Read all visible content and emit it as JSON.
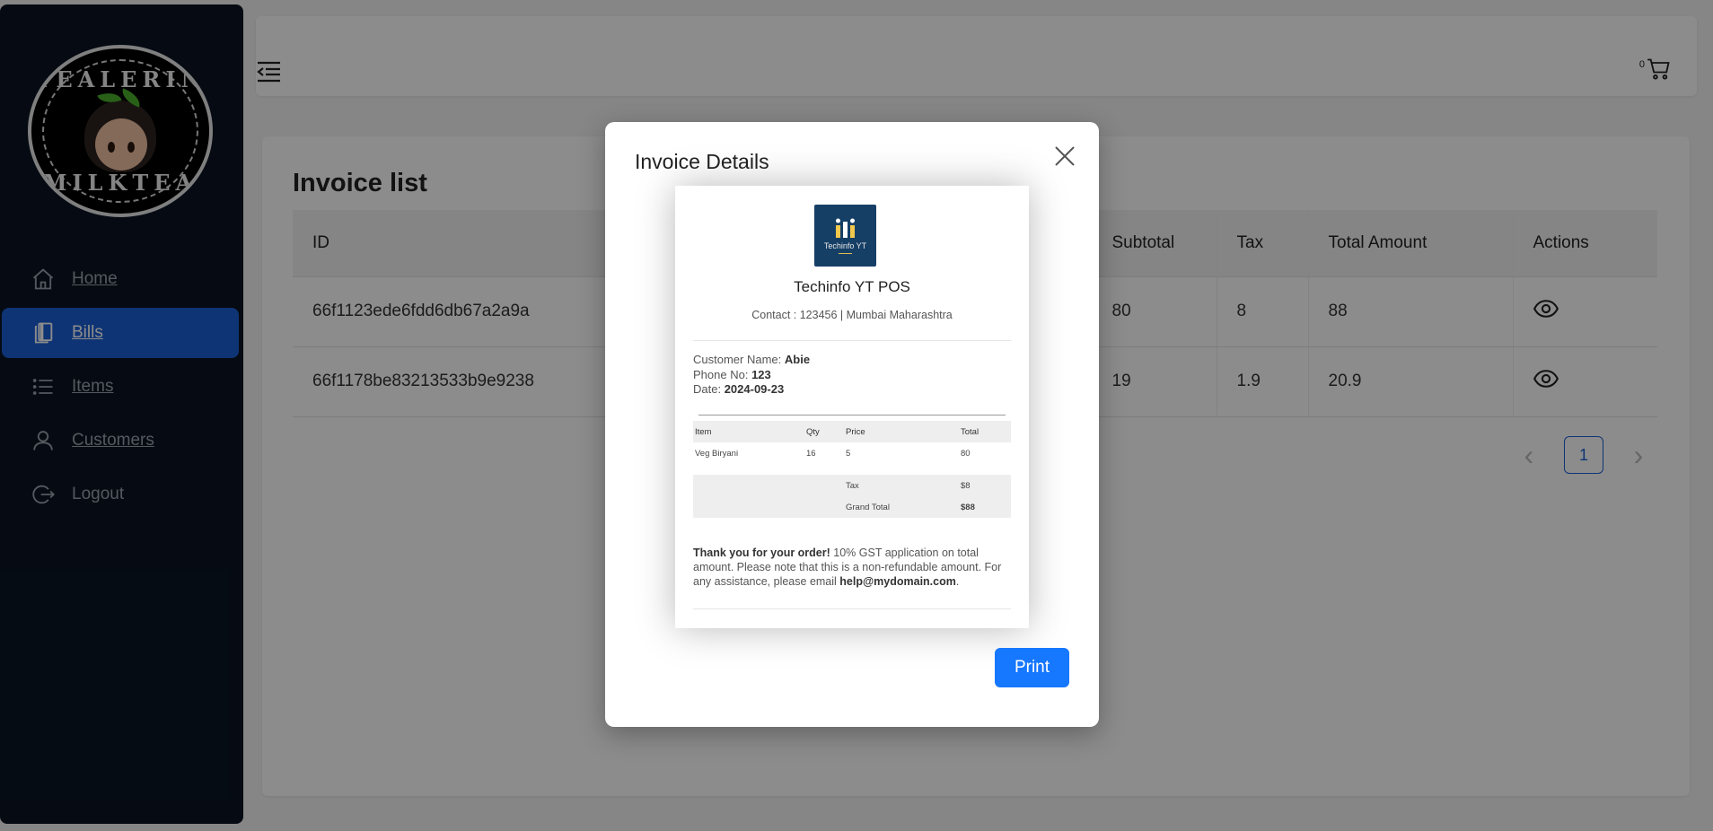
{
  "brand": {
    "logo_top": "TEALERIN",
    "logo_bottom": "MILKTEA"
  },
  "sidebar": {
    "items": [
      {
        "label": "Home",
        "icon": "home-icon"
      },
      {
        "label": "Bills",
        "icon": "bills-icon",
        "active": true
      },
      {
        "label": "Items",
        "icon": "list-icon"
      },
      {
        "label": "Customers",
        "icon": "user-icon"
      },
      {
        "label": "Logout",
        "icon": "logout-icon"
      }
    ]
  },
  "header": {
    "cart_count": "0"
  },
  "main": {
    "title": "Invoice list",
    "columns": [
      "ID",
      "Subtotal",
      "Tax",
      "Total Amount",
      "Actions"
    ],
    "rows": [
      {
        "id": "66f1123ede6fdd6db67a2a9a",
        "subtotal": "80",
        "tax": "8",
        "total": "88"
      },
      {
        "id": "66f1178be83213533b9e9238",
        "subtotal": "19",
        "tax": "1.9",
        "total": "20.9"
      }
    ],
    "pagination": {
      "current": "1"
    }
  },
  "modal": {
    "title": "Invoice Details",
    "print_label": "Print",
    "receipt": {
      "logo_text": "Techinfo YT",
      "shop_name": "Techinfo YT POS",
      "contact": "Contact : 123456 | Mumbai Maharashtra",
      "customer_label": "Customer Name:",
      "customer_value": "Abie",
      "phone_label": "Phone No:",
      "phone_value": "123",
      "date_label": "Date:",
      "date_value": "2024-09-23",
      "columns": [
        "Item",
        "Qty",
        "Price",
        "Total"
      ],
      "items": [
        {
          "item": "Veg Biryani",
          "qty": "16",
          "price": "5",
          "total": "80"
        }
      ],
      "tax_label": "Tax",
      "tax_value": "$8",
      "grand_label": "Grand Total",
      "grand_value": "$88",
      "note_bold": "Thank you for your order!",
      "note_text": " 10% GST application on total amount. Please note that this is a non-refundable amount. For any assistance, please email ",
      "note_email": "help@mydomain.com",
      "note_end": "."
    }
  },
  "colors": {
    "sidebar_bg": "#0b1524",
    "active": "#1d5fd6",
    "print": "#1677ff"
  }
}
